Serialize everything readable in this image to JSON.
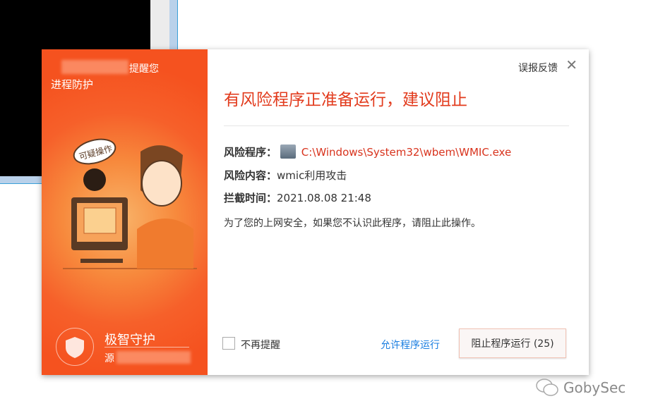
{
  "left_panel": {
    "header_suffix": "提醒您",
    "subtitle": "进程防护",
    "bubble": "可疑操作",
    "brand": "极智守护",
    "source_prefix": "源"
  },
  "header": {
    "feedback": "误报反馈",
    "close": "✕"
  },
  "title": "有风险程序正准备运行，建议阻止",
  "details": [
    {
      "label": "风险程序：",
      "value": "C:\\Windows\\System32\\wbem\\WMIC.exe"
    },
    {
      "label": "风险内容：",
      "value": "wmic利用攻击"
    },
    {
      "label": "拦截时间：",
      "value": "2021.08.08 21:48"
    }
  ],
  "note": "为了您的上网安全，如果您不认识此程序，请阻止此操作。",
  "footer": {
    "dont_remind": "不再提醒",
    "allow": "允许程序运行",
    "block": "阻止程序运行 (25)"
  },
  "watermark": "GobySec",
  "colors": {
    "accent": "#f5521f",
    "danger": "#e23b1d",
    "link": "#1a7ee0"
  }
}
